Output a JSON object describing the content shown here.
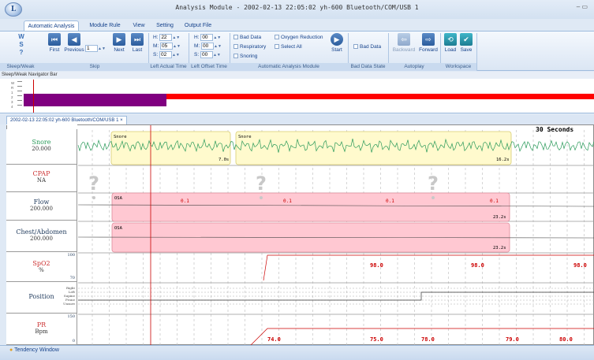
{
  "window": {
    "app_button": "L",
    "title": "Analysis Module - 2002-02-13 22:05:02  yh-600  Bluetooth/COM/USB  1",
    "controls": "–  ▭"
  },
  "tabs": [
    "Automatic Analysis",
    "Module Rule",
    "View",
    "Setting",
    "Output File"
  ],
  "ribbon": {
    "wsk": [
      "W",
      "S",
      "?"
    ],
    "groups": [
      "Sleep/Weak",
      "Skip",
      "Left Actual Time",
      "Left Offset Time",
      "Automatic Analysis Module",
      "Bad Data State",
      "Autoplay",
      "Workspace"
    ],
    "skip": {
      "first": "First",
      "previous": "Previous",
      "count": "1",
      "next": "Next",
      "last": "Last"
    },
    "actual_time": {
      "h_label": "H:",
      "h": "22",
      "m_label": "M:",
      "m": "05",
      "s_label": "S:",
      "s": "02"
    },
    "offset_time": {
      "h_label": "H:",
      "h": "00",
      "m_label": "M:",
      "m": "00",
      "s_label": "S:",
      "s": "00"
    },
    "analysis": {
      "bad_data": "Bad Data",
      "oxygen_reduction": "Oxygen Reduction",
      "respiratory": "Respiratory",
      "select_all": "Select All",
      "snoring": "Snoring",
      "start": "Start"
    },
    "bad_data_state": {
      "bad_data": "Bad Data"
    },
    "autoplay": {
      "backward": "Backward",
      "forward": "Forward"
    },
    "workspace": {
      "load": "Load",
      "save": "Save"
    }
  },
  "navigator": {
    "title": "Sleep/Weak Navigator Bar",
    "levels": [
      "W",
      "R",
      "1",
      "2",
      "3",
      "4"
    ],
    "colors": {
      "purple": "#800080",
      "red": "#ff0000"
    }
  },
  "document_tab": {
    "label": "2002-02-13 22:05:02  yh-600  Bluetooth/COM/USB  1",
    "close": "×"
  },
  "plot": {
    "window_label": "30 Seconds",
    "channels": [
      {
        "name": "Snore",
        "scale": "20.000"
      },
      {
        "name": "CPAP",
        "scale": "NA"
      },
      {
        "name": "Flow",
        "scale": "200.000"
      },
      {
        "name": "Chest/Abdomen",
        "scale": "200.000"
      },
      {
        "name": "SpO2",
        "scale": "%",
        "max": "100",
        "min": "70"
      },
      {
        "name": "Position",
        "scale": "",
        "levels": [
          "Right",
          "Left",
          "Supine",
          "Prone",
          "Unsure"
        ]
      },
      {
        "name": "PR",
        "scale": "Bpm",
        "max": "150",
        "min": "0"
      }
    ],
    "events": {
      "snore": [
        {
          "label": "Snore",
          "duration": "7.0s"
        },
        {
          "label": "Snore",
          "duration": "16.2s"
        }
      ],
      "flow": {
        "label": "OSA",
        "duration": "23.2s",
        "marks": [
          "0.1",
          "0.1",
          "0.1",
          "0.1"
        ]
      },
      "chest": {
        "label": "OSA",
        "duration": "23.2s"
      }
    },
    "spo2_values": [
      "98.0",
      "98.0",
      "98.0"
    ],
    "pr_values": [
      "74.0",
      "75.0",
      "78.0",
      "79.0",
      "80.0"
    ]
  },
  "status": {
    "tendency_window": "Tendency Window"
  }
}
